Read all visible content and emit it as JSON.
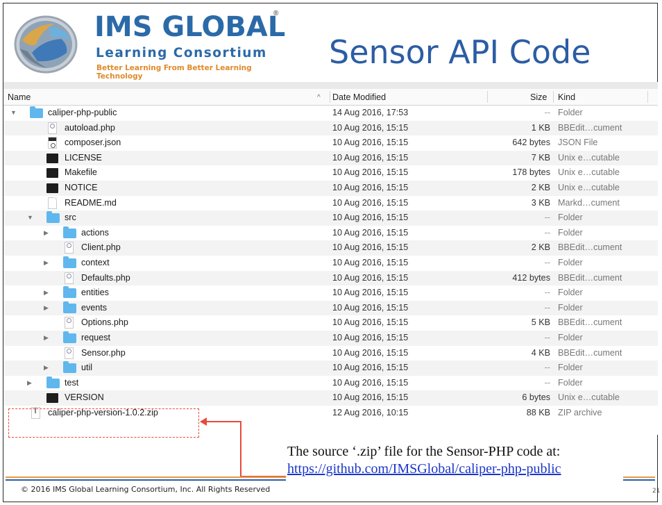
{
  "logo": {
    "title": "IMS GLOBAL",
    "reg": "®",
    "subtitle": "Learning Consortium",
    "tagline": "Better Learning From Better Learning Technology"
  },
  "slide_title": "Sensor API Code",
  "finder": {
    "columns": {
      "name": "Name",
      "sort_indicator": "^",
      "date": "Date Modified",
      "size": "Size",
      "kind": "Kind"
    },
    "rows": [
      {
        "name": "caliper-php-public",
        "date": "14 Aug 2016, 17:53",
        "size": "--",
        "kind": "Folder",
        "icon": "folder-icon",
        "indent": 0,
        "disclosure": "open"
      },
      {
        "name": "autoload.php",
        "date": "10 Aug 2016, 15:15",
        "size": "1 KB",
        "kind": "BBEdit…cument",
        "icon": "php-file-icon",
        "indent": 1,
        "disclosure": "none"
      },
      {
        "name": "composer.json",
        "date": "10 Aug 2016, 15:15",
        "size": "642 bytes",
        "kind": "JSON File",
        "icon": "json-file-icon",
        "indent": 1,
        "disclosure": "none"
      },
      {
        "name": "LICENSE",
        "date": "10 Aug 2016, 15:15",
        "size": "7 KB",
        "kind": "Unix e…cutable",
        "icon": "exec-file-icon",
        "indent": 1,
        "disclosure": "none"
      },
      {
        "name": "Makefile",
        "date": "10 Aug 2016, 15:15",
        "size": "178 bytes",
        "kind": "Unix e…cutable",
        "icon": "exec-file-icon",
        "indent": 1,
        "disclosure": "none"
      },
      {
        "name": "NOTICE",
        "date": "10 Aug 2016, 15:15",
        "size": "2 KB",
        "kind": "Unix e…cutable",
        "icon": "exec-file-icon",
        "indent": 1,
        "disclosure": "none"
      },
      {
        "name": "README.md",
        "date": "10 Aug 2016, 15:15",
        "size": "3 KB",
        "kind": "Markd…cument",
        "icon": "document-icon",
        "indent": 1,
        "disclosure": "none"
      },
      {
        "name": "src",
        "date": "10 Aug 2016, 15:15",
        "size": "--",
        "kind": "Folder",
        "icon": "folder-icon",
        "indent": 1,
        "disclosure": "open"
      },
      {
        "name": "actions",
        "date": "10 Aug 2016, 15:15",
        "size": "--",
        "kind": "Folder",
        "icon": "folder-icon",
        "indent": 2,
        "disclosure": "closed"
      },
      {
        "name": "Client.php",
        "date": "10 Aug 2016, 15:15",
        "size": "2 KB",
        "kind": "BBEdit…cument",
        "icon": "php-file-icon",
        "indent": 2,
        "disclosure": "none"
      },
      {
        "name": "context",
        "date": "10 Aug 2016, 15:15",
        "size": "--",
        "kind": "Folder",
        "icon": "folder-icon",
        "indent": 2,
        "disclosure": "closed"
      },
      {
        "name": "Defaults.php",
        "date": "10 Aug 2016, 15:15",
        "size": "412 bytes",
        "kind": "BBEdit…cument",
        "icon": "php-file-icon",
        "indent": 2,
        "disclosure": "none"
      },
      {
        "name": "entities",
        "date": "10 Aug 2016, 15:15",
        "size": "--",
        "kind": "Folder",
        "icon": "folder-icon",
        "indent": 2,
        "disclosure": "closed"
      },
      {
        "name": "events",
        "date": "10 Aug 2016, 15:15",
        "size": "--",
        "kind": "Folder",
        "icon": "folder-icon",
        "indent": 2,
        "disclosure": "closed"
      },
      {
        "name": "Options.php",
        "date": "10 Aug 2016, 15:15",
        "size": "5 KB",
        "kind": "BBEdit…cument",
        "icon": "php-file-icon",
        "indent": 2,
        "disclosure": "none"
      },
      {
        "name": "request",
        "date": "10 Aug 2016, 15:15",
        "size": "--",
        "kind": "Folder",
        "icon": "folder-icon",
        "indent": 2,
        "disclosure": "closed"
      },
      {
        "name": "Sensor.php",
        "date": "10 Aug 2016, 15:15",
        "size": "4 KB",
        "kind": "BBEdit…cument",
        "icon": "php-file-icon",
        "indent": 2,
        "disclosure": "none"
      },
      {
        "name": "util",
        "date": "10 Aug 2016, 15:15",
        "size": "--",
        "kind": "Folder",
        "icon": "folder-icon",
        "indent": 2,
        "disclosure": "closed"
      },
      {
        "name": "test",
        "date": "10 Aug 2016, 15:15",
        "size": "--",
        "kind": "Folder",
        "icon": "folder-icon",
        "indent": 1,
        "disclosure": "closed"
      },
      {
        "name": "VERSION",
        "date": "10 Aug 2016, 15:15",
        "size": "6 bytes",
        "kind": "Unix e…cutable",
        "icon": "exec-file-icon",
        "indent": 1,
        "disclosure": "none"
      },
      {
        "name": "caliper-php-version-1.0.2.zip",
        "date": "12 Aug 2016, 10:15",
        "size": "88 KB",
        "kind": "ZIP archive",
        "icon": "zip-file-icon",
        "indent": 0,
        "disclosure": "none"
      }
    ]
  },
  "callout": {
    "line1": "The source ‘.zip’ file for the Sensor-PHP code at:",
    "link": "https://github.com/IMSGlobal/caliper-php-public"
  },
  "footer": {
    "copyright": "© 2016 IMS Global Learning Consortium, Inc.  All Rights Reserved",
    "page_number": "21"
  },
  "colors": {
    "brand_blue": "#2b6aa8",
    "title_blue": "#2b5da3",
    "accent_orange": "#e59a3a",
    "callout_red": "#e8493a",
    "folder_blue": "#5fb7ee",
    "link_blue": "#1a35c9"
  }
}
